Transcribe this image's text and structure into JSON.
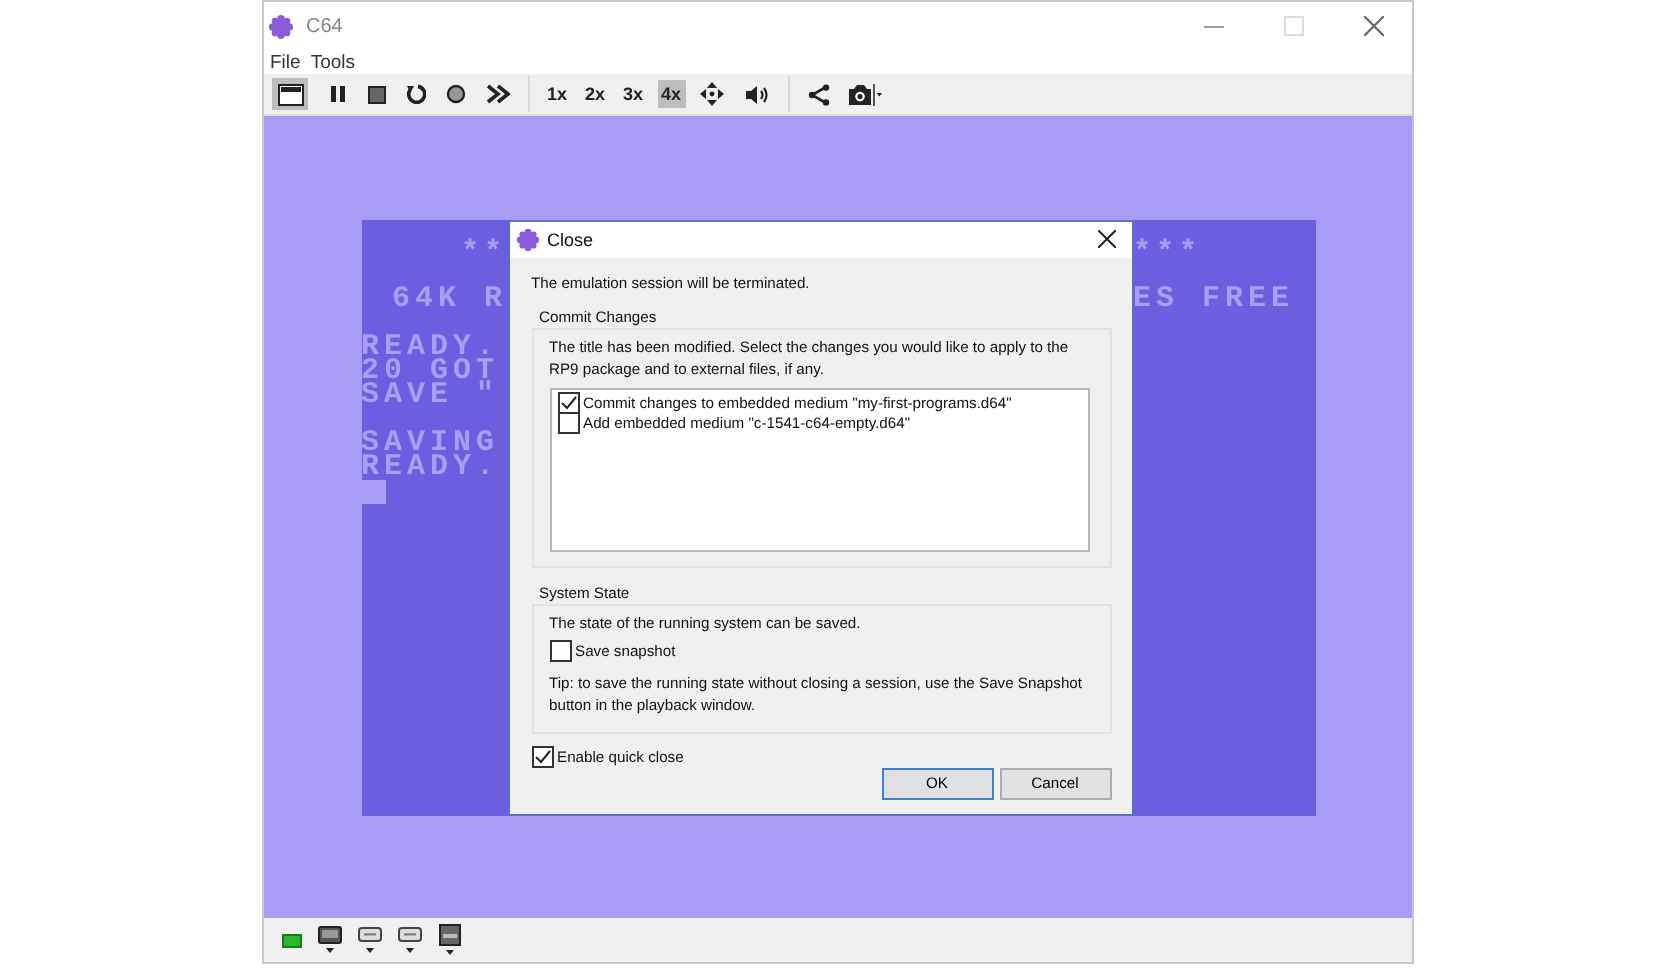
{
  "window": {
    "title": "C64"
  },
  "menu": [
    "File",
    "Tools"
  ],
  "toolbar": {
    "view_button": {
      "selected": true
    },
    "zoom_buttons": [
      {
        "label": "1x",
        "selected": false
      },
      {
        "label": "2x",
        "selected": false
      },
      {
        "label": "3x",
        "selected": false
      },
      {
        "label": "4x",
        "selected": true
      }
    ]
  },
  "screen": {
    "banner_left": [
      "**",
      "64K R"
    ],
    "banner_right": [
      "***",
      "ES FREE"
    ],
    "output_blocks": [
      [
        "READY.",
        "20 GOT",
        "SAVE \""
      ],
      [
        "SAVING",
        "READY."
      ]
    ],
    "cursor": true
  },
  "dialog": {
    "title": "Close",
    "message": "The emulation session will be terminated.",
    "commit_group": {
      "title": "Commit Changes",
      "description": "The title has been modified. Select the changes you would like to apply to the RP9 package and to external files, if any.",
      "items": [
        {
          "label": "Commit changes to embedded medium \"my-first-programs.d64\"",
          "checked": true
        },
        {
          "label": "Add embedded medium \"c-1541-c64-empty.d64\"",
          "checked": false
        }
      ]
    },
    "system_group": {
      "title": "System State",
      "description": "The state of the running system can be saved.",
      "snapshot": {
        "label": "Save snapshot",
        "checked": false
      },
      "tip": "Tip: to save the running state without closing a session, use the Save Snapshot button in the playback window."
    },
    "quick_close": {
      "label": "Enable quick close",
      "checked": true
    },
    "buttons": [
      {
        "label": "OK",
        "default": true
      },
      {
        "label": "Cancel",
        "default": false
      }
    ]
  }
}
